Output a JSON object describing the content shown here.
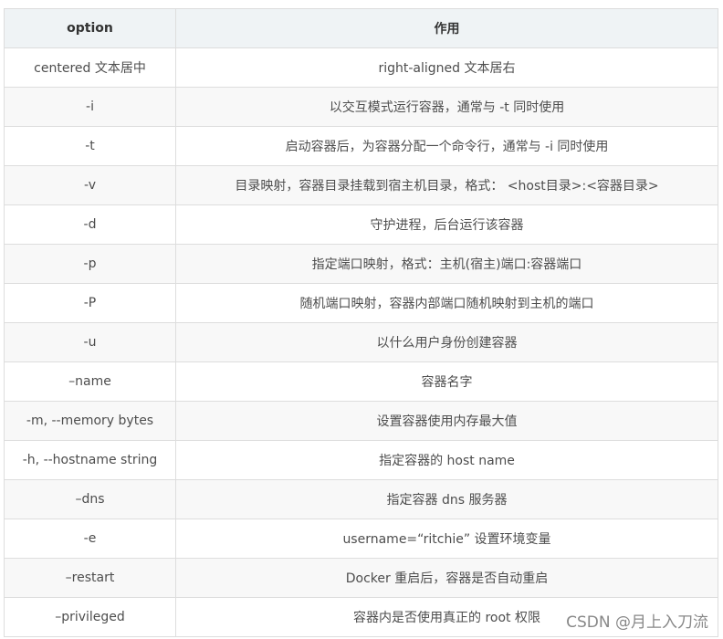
{
  "table": {
    "headers": [
      "option",
      "作用"
    ],
    "rows": [
      [
        "centered 文本居中",
        "right-aligned 文本居右"
      ],
      [
        "-i",
        "以交互模式运行容器，通常与 -t 同时使用"
      ],
      [
        "-t",
        "启动容器后，为容器分配一个命令行，通常与 -i 同时使用"
      ],
      [
        "-v",
        "目录映射，容器目录挂载到宿主机目录，格式： <host目录>:<容器目录>"
      ],
      [
        "-d",
        "守护进程，后台运行该容器"
      ],
      [
        "-p",
        "指定端口映射，格式：主机(宿主)端口:容器端口"
      ],
      [
        "-P",
        "随机端口映射，容器内部端口随机映射到主机的端口"
      ],
      [
        "-u",
        "以什么用户身份创建容器"
      ],
      [
        "–name",
        "容器名字"
      ],
      [
        "-m, --memory bytes",
        "设置容器使用内存最大值"
      ],
      [
        "-h, --hostname string",
        "指定容器的 host name"
      ],
      [
        "–dns",
        "指定容器 dns 服务器"
      ],
      [
        "-e",
        "username=“ritchie” 设置环境变量"
      ],
      [
        "–restart",
        "Docker 重启后，容器是否自动重启"
      ],
      [
        "–privileged",
        "容器内是否使用真正的 root 权限"
      ]
    ]
  },
  "watermark": "CSDN @月上入刀流"
}
